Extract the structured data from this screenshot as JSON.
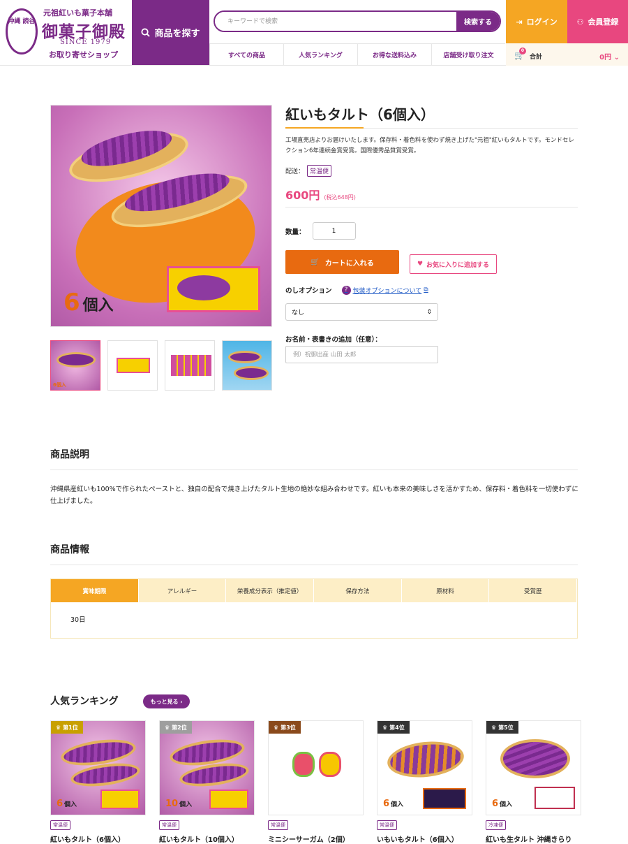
{
  "header": {
    "logo_seal": "沖縄 読谷",
    "logo_sub": "元祖紅いも菓子本舗",
    "logo_name": "御菓子御殿",
    "logo_since": "SINCE 1979",
    "logo_shop": "お取り寄せショップ",
    "find_label": "商品を探す",
    "search_placeholder": "キーワードで検索",
    "search_button": "検索する",
    "nav": [
      "すべての商品",
      "人気ランキング",
      "お得な送料込み",
      "店舗受け取り注文"
    ],
    "login": "ログイン",
    "register": "会員登録",
    "cart_label": "合計",
    "cart_badge": "0",
    "cart_amount": "0円"
  },
  "product": {
    "main_count": "6",
    "main_count_unit": "個入",
    "thumb_count": "6個入",
    "title": "紅いもタルト（6個入）",
    "lead": "工場直売店よりお届けいたします。保存料・着色料を使わず焼き上げた\"元祖\"紅いもタルトです。モンドセレクション6年連続金賞受賞。国際優秀品質賞受賞。",
    "ship_label": "配送：",
    "ship_tag": "常温便",
    "price": "600円",
    "price_tax": "(税込648円)",
    "qty_label": "数量：",
    "qty_value": "1",
    "add_cart": "カートに入れる",
    "favorite": "お気に入りに追加する",
    "noshi_label": "のしオプション",
    "noshi_help": "包装オプションについて",
    "noshi_value": "なし",
    "name_label": "お名前・表書きの追加（任意）：",
    "name_placeholder": "例）祝御出産 山田 太郎"
  },
  "description": {
    "heading": "商品説明",
    "text": "沖縄県産紅いも100%で作られたペーストと、独自の配合で焼き上げたタルト生地の絶妙な組み合わせです。紅いも本来の美味しさを活かすため、保存料・着色料を一切使わずに仕上げました。"
  },
  "info": {
    "heading": "商品情報",
    "tabs": [
      "賞味期限",
      "アレルギー",
      "栄養成分表示（推定値）",
      "保存方法",
      "原材料",
      "受賞歴"
    ],
    "active_value": "30日"
  },
  "ranking": {
    "heading": "人気ランキング",
    "more": "もっと見る",
    "items": [
      {
        "rank": "第1位",
        "count": "6",
        "unit": "個入",
        "tag": "常温便",
        "name": "紅いもタルト（6個入）"
      },
      {
        "rank": "第2位",
        "count": "10",
        "unit": "個入",
        "tag": "常温便",
        "name": "紅いもタルト（10個入）"
      },
      {
        "rank": "第3位",
        "count": "",
        "unit": "",
        "tag": "常温便",
        "name": "ミニシーサーガム（2個）"
      },
      {
        "rank": "第4位",
        "count": "6",
        "unit": "個入",
        "tag": "常温便",
        "name": "いもいもタルト（6個入）"
      },
      {
        "rank": "第5位",
        "count": "6",
        "unit": "個入",
        "tag": "冷凍便",
        "name": "紅いも生タルト 沖縄きらり"
      }
    ]
  },
  "colors": {
    "brand": "#7b2a87",
    "accent_orange": "#e86a10",
    "accent_pink": "#e8477f",
    "accent_yellow": "#f5a623"
  }
}
